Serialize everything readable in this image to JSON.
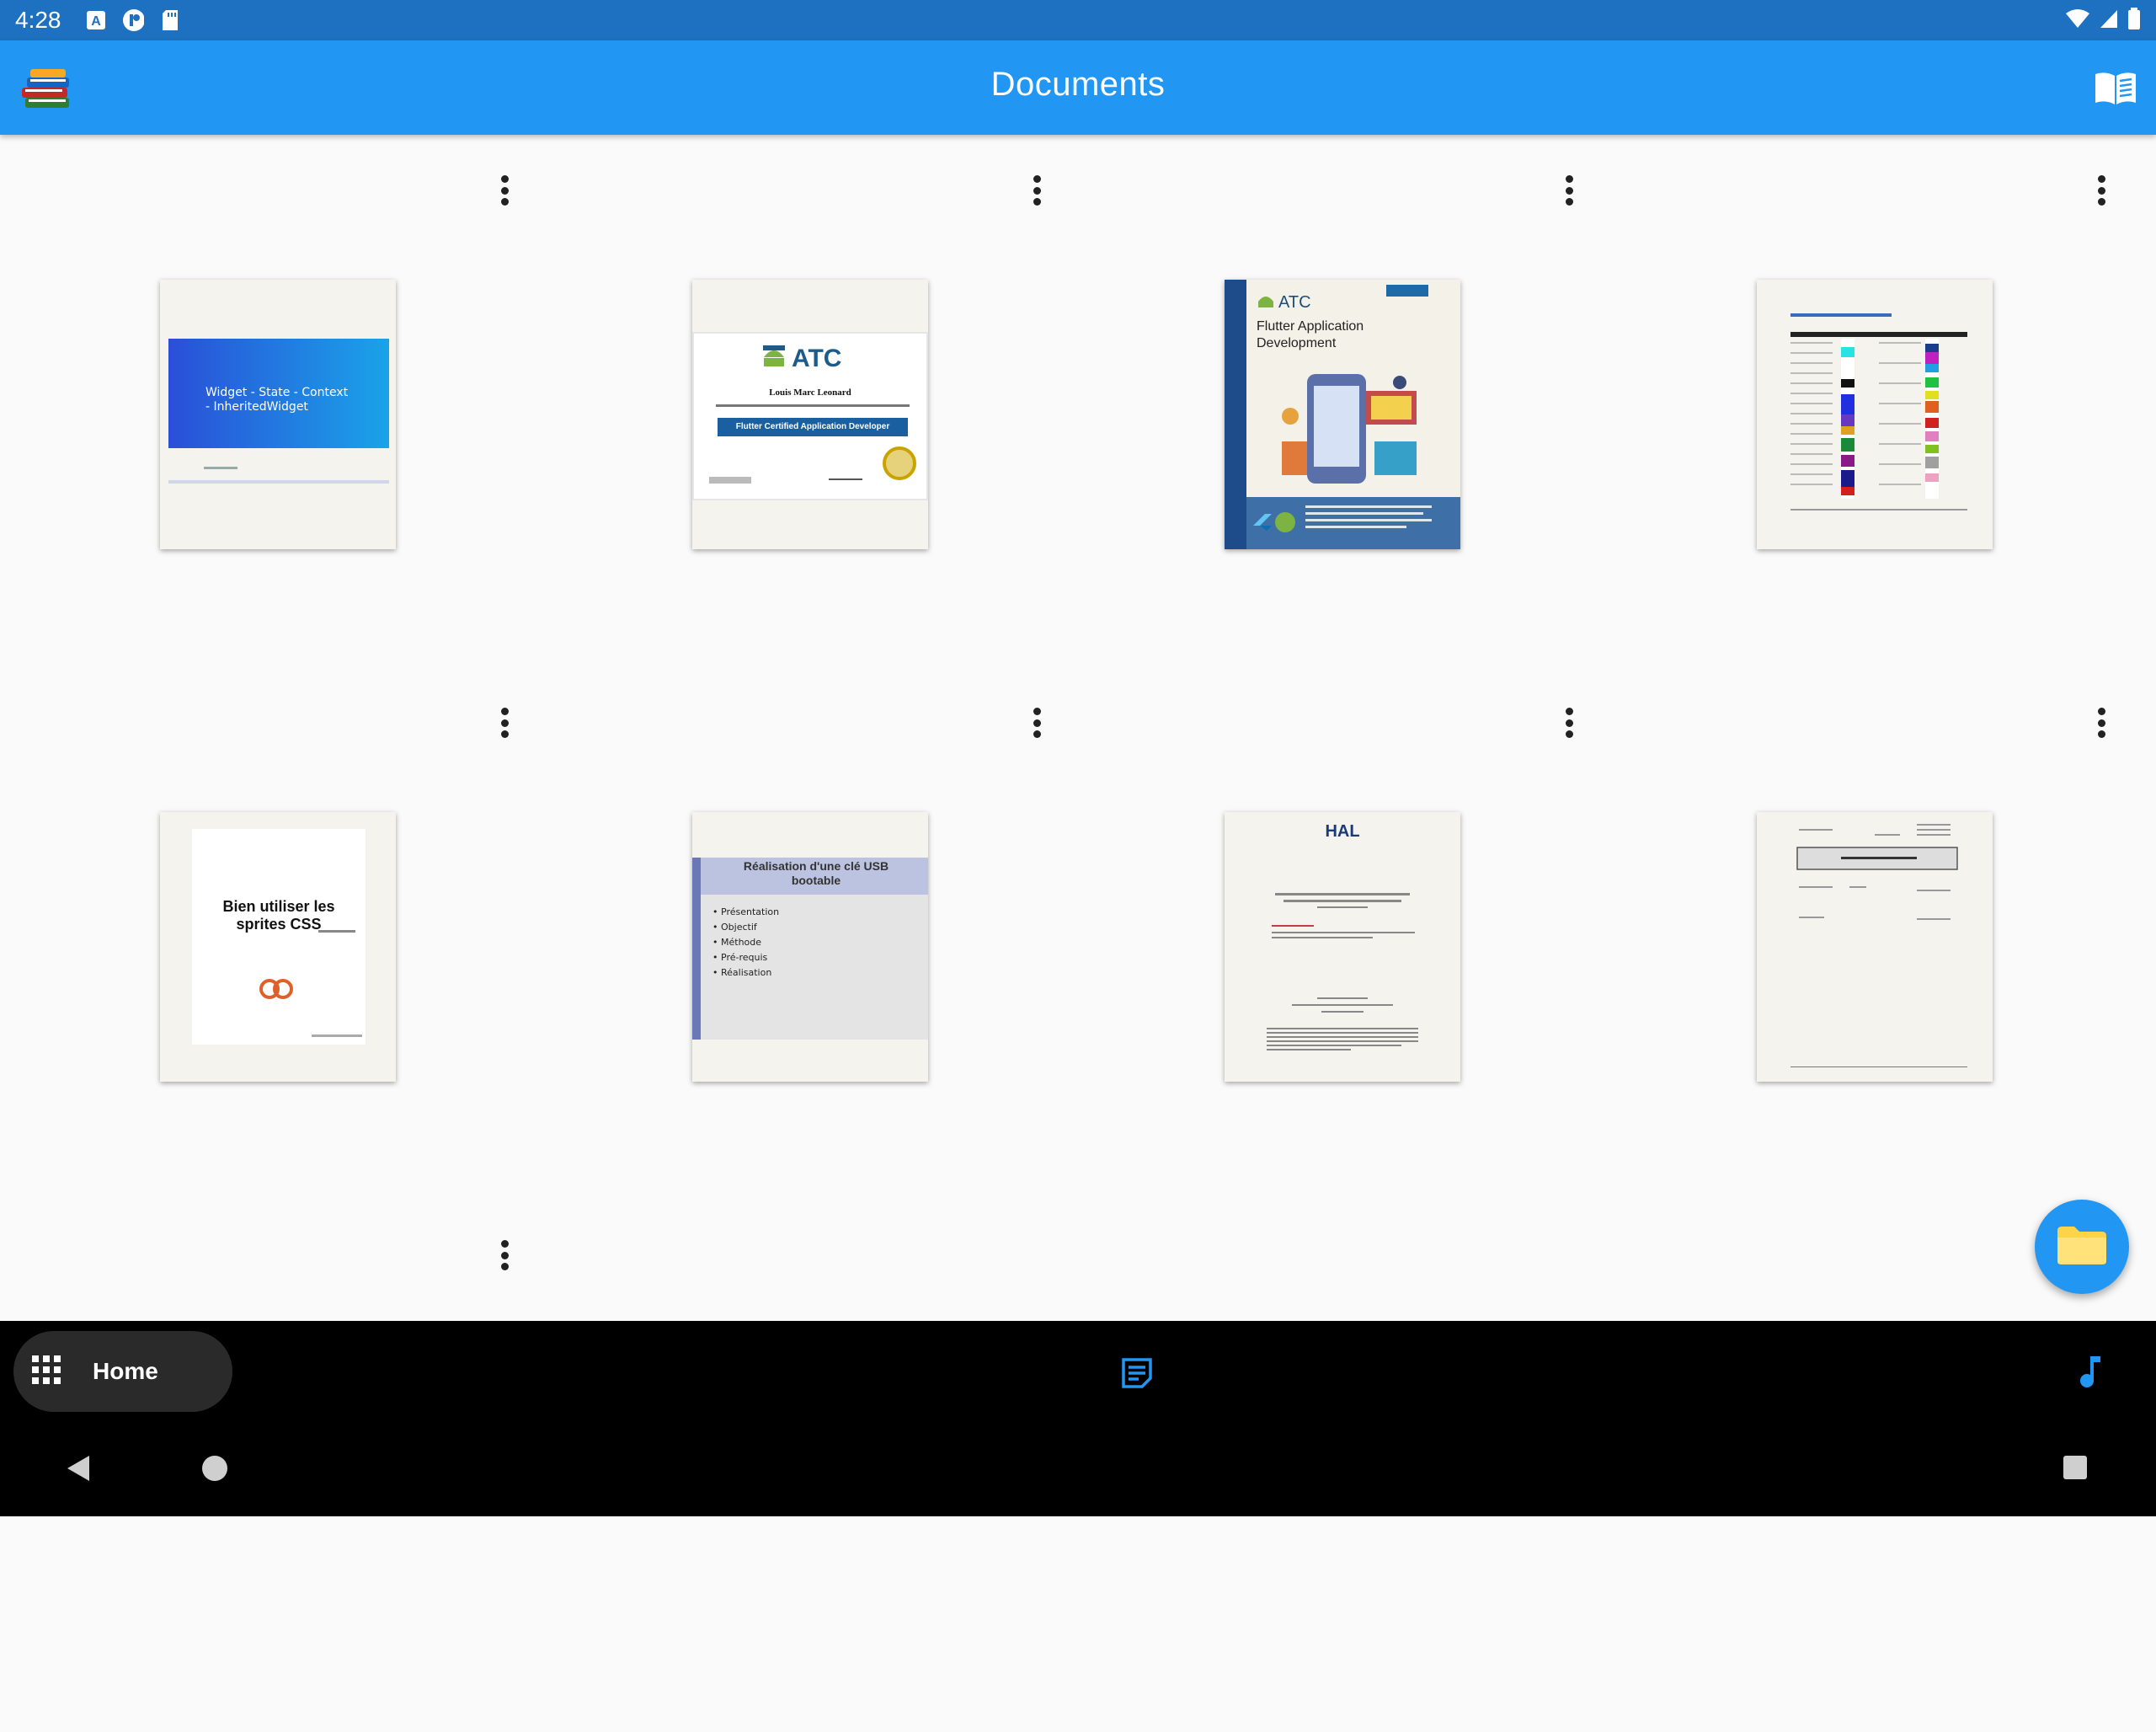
{
  "status_bar": {
    "time": "4:28",
    "left_icons": [
      "a-box-icon",
      "vpn-icon",
      "sd-card-icon"
    ],
    "right_icons": [
      "wifi-icon",
      "signal-icon",
      "battery-icon"
    ]
  },
  "app_bar": {
    "title": "Documents",
    "logo_icon": "books-icon",
    "action_icon": "open-book-icon",
    "color": "#2296f3"
  },
  "documents": [
    {
      "thumb_lines": [
        "Widget - State - Context",
        "- InheritedWidget"
      ]
    },
    {
      "thumb_brand": "ATC",
      "thumb_name": "Louis Marc Leonard",
      "thumb_band": "Flutter Certified Application Developer"
    },
    {
      "thumb_brand": "ATC",
      "thumb_title": [
        "Flutter Application",
        "Development"
      ]
    },
    {
      "thumb_kind": "color-table"
    },
    {
      "thumb_title": [
        "Bien utiliser les",
        "sprites CSS"
      ]
    },
    {
      "thumb_title": [
        "Réalisation d'une clé USB",
        "bootable"
      ],
      "thumb_list": [
        "Présentation",
        "Objectif",
        "Méthode",
        "Pré-requis",
        "Réalisation"
      ]
    },
    {
      "thumb_brand": "HAL"
    },
    {
      "thumb_kind": "form"
    },
    {
      "thumb_kind": "empty"
    }
  ],
  "fab": {
    "icon": "folder-icon"
  },
  "taskbar": {
    "home_label": "Home",
    "apps_icon": "apps-grid-icon",
    "pinned": [
      "notes-icon",
      "music-note-icon"
    ]
  }
}
